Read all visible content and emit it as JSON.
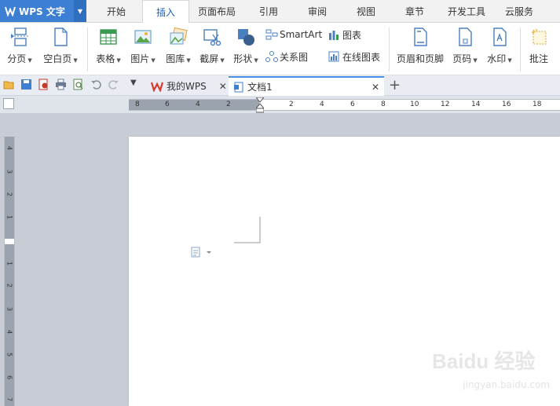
{
  "app": {
    "name": "WPS 文字"
  },
  "menu_tabs": [
    "开始",
    "插入",
    "页面布局",
    "引用",
    "审阅",
    "视图",
    "章节",
    "开发工具",
    "云服务"
  ],
  "active_menu_tab": "插入",
  "ribbon": {
    "page_break": "分页",
    "blank_page": "空白页",
    "table": "表格",
    "picture": "图片",
    "gallery": "图库",
    "screenshot": "截屏",
    "shapes": "形状",
    "smartart": "SmartArt",
    "relationship": "关系图",
    "chart": "图表",
    "online_chart": "在线图表",
    "header_footer": "页眉和页脚",
    "page_number": "页码",
    "watermark": "水印",
    "comment": "批注"
  },
  "doc_tabs": [
    {
      "label": "我的WPS"
    },
    {
      "label": "文档1"
    }
  ],
  "ruler": {
    "h_left": [
      "8",
      "6",
      "4",
      "2"
    ],
    "h_right": [
      "2",
      "4",
      "6",
      "8",
      "10",
      "12",
      "14",
      "16",
      "18"
    ],
    "v_top": [
      "4",
      "3",
      "2",
      "1"
    ],
    "v_bottom": [
      "1",
      "2",
      "3",
      "4",
      "5",
      "6",
      "7"
    ]
  },
  "watermark_text": "Baidu 经验",
  "watermark_sub": "jingyan.baidu.com",
  "colors": {
    "accent": "#3d7fd2",
    "active_tab_text": "#1a5fb4",
    "workspace": "#c8ccd4"
  }
}
